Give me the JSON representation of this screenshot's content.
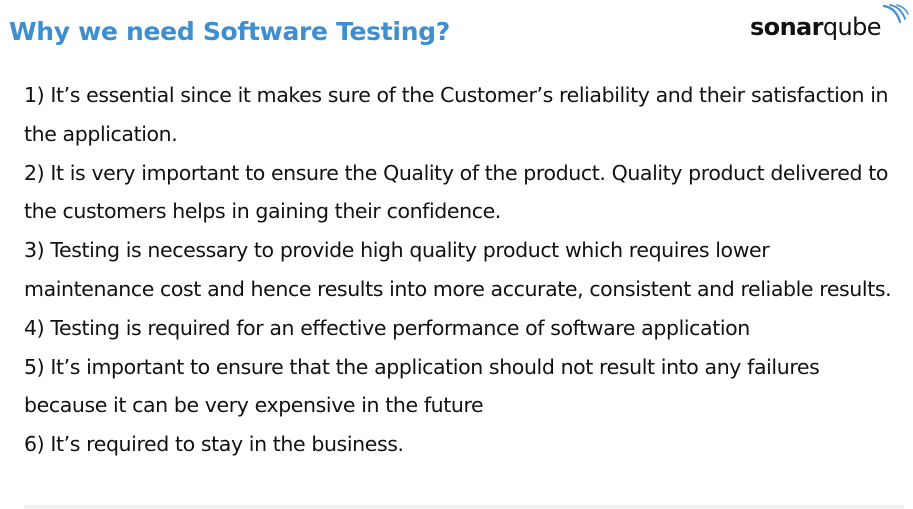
{
  "slide": {
    "title": "Why we need Software Testing?",
    "logo": {
      "brand_bold": "sonar",
      "brand_light": "qube",
      "icon": "sound-waves-icon"
    },
    "points": [
      "1) It’s essential since it makes sure of the Customer’s reliability and their satisfaction in the application.",
      "2) It is very important to ensure the Quality of the product. Quality product delivered to the customers helps in gaining their confidence.",
      "3) Testing is necessary to provide high quality product which requires lower maintenance cost and hence results into more accurate, consistent and reliable results.",
      "4) Testing is required for an effective performance of software application",
      "5) It’s important to ensure that the application should not result into any failures because it can be very expensive in the future",
      "6) It’s required to stay in the business."
    ],
    "colors": {
      "title": "#3e8ed0",
      "text": "#111111",
      "background": "#ffffff"
    }
  }
}
